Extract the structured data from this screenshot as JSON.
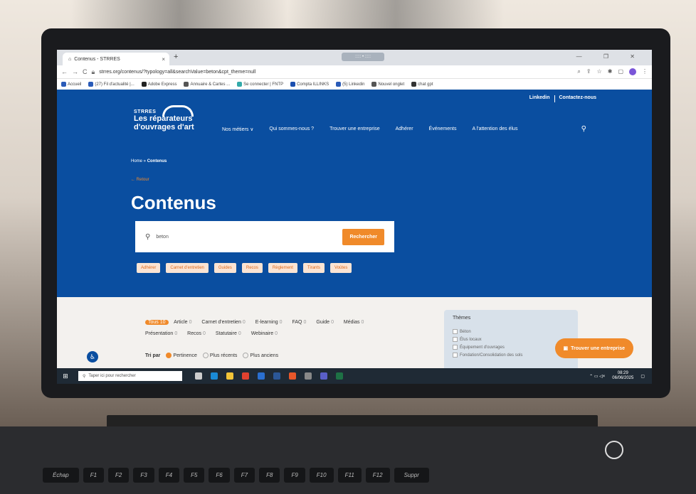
{
  "browser": {
    "tab_title": "Contenus - STRRES",
    "tab_close": "×",
    "new_tab": "+",
    "ext_strip": "::::: • :::::",
    "window_controls": "—  ❐  ✕",
    "url": "strres.org/contenus/?typology=all&searchValue=beton&cpt_theme=null",
    "bookmarks": [
      "Accueil",
      "(27) Fil d'actualité |...",
      "Adobe Express",
      "Annuaire & Cartes ...",
      "Se connecter | FNTP",
      "Compta ILLINKS",
      "(5) Linkedin",
      "Nouvel onglet",
      "chat gpt"
    ]
  },
  "site": {
    "toplinks": [
      "Linkedin",
      "Contactez-nous"
    ],
    "logo": {
      "brand": "STRRES",
      "line1": "Les réparateurs",
      "line2": "d'ouvrages d'art"
    },
    "nav": [
      "Nos métiers  ∨",
      "Qui sommes-nous ?",
      "Trouver une entreprise",
      "Adhérer",
      "Événements",
      "A l'attention des élus"
    ],
    "breadcrumb": {
      "home": "Home",
      "sep": " » ",
      "current": "Contenus"
    },
    "back": "← Retour",
    "page_title": "Contenus",
    "search": {
      "value": "beton",
      "button": "Rechercher"
    },
    "chips": [
      "Adhérer",
      "Carnet d'entretien",
      "Guides",
      "Recos",
      "Règlement",
      "Tirants",
      "Voûtes"
    ],
    "filters": [
      {
        "label": "Tous",
        "count": "10",
        "active": true
      },
      {
        "label": "Article",
        "count": "0"
      },
      {
        "label": "Carnet d'entretien",
        "count": "0"
      },
      {
        "label": "E-learning",
        "count": "0"
      },
      {
        "label": "FAQ",
        "count": "0"
      },
      {
        "label": "Guide",
        "count": "0"
      },
      {
        "label": "Médias",
        "count": "0"
      },
      {
        "label": "Présentation",
        "count": "0"
      },
      {
        "label": "Recos",
        "count": "0"
      },
      {
        "label": "Statutaire",
        "count": "0"
      },
      {
        "label": "Webinaire",
        "count": "0"
      }
    ],
    "sort": {
      "label": "Tri par",
      "options": [
        "Pertinence",
        "Plus récents",
        "Plus anciens"
      ]
    },
    "themes": {
      "title": "Thèmes",
      "items": [
        "Béton",
        "Élus locaux",
        "Équipement d'ouvrages",
        "Fondation/Consolidation des sols"
      ]
    },
    "cta": "Trouver une entreprise"
  },
  "taskbar": {
    "search_placeholder": "Taper ici pour rechercher",
    "time": "08:29",
    "date": "06/06/2025"
  },
  "keyboard": [
    "Échap",
    "F1",
    "F2",
    "F3",
    "F4",
    "F5",
    "F6",
    "F7",
    "F8",
    "F9",
    "F10",
    "F11",
    "F12",
    "Suppr"
  ],
  "colors": {
    "brand_blue": "#0a4ea0",
    "accent_orange": "#f08a2a"
  }
}
